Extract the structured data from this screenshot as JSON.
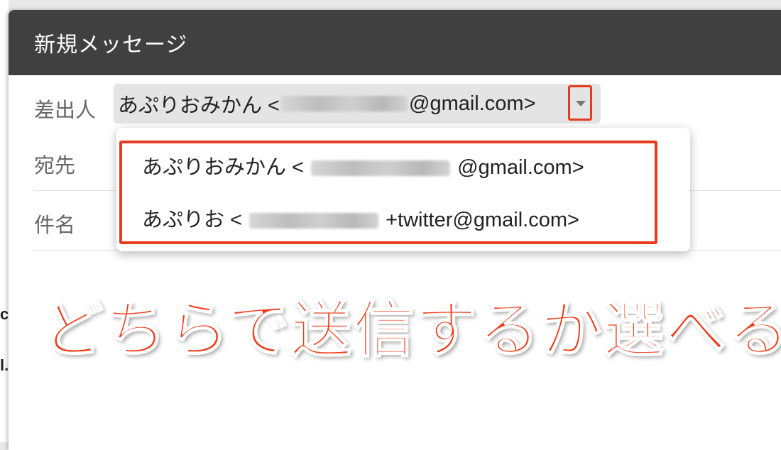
{
  "compose": {
    "title": "新規メッセージ",
    "from_label": "差出人",
    "from_value": {
      "name": "あぷりおみかん <",
      "domain": "@gmail.com>"
    },
    "to_label": "宛先",
    "subject_label": "件名"
  },
  "from_menu": {
    "items": [
      {
        "name": "あぷりおみかん <",
        "domain": "@gmail.com>"
      },
      {
        "name": "あぷりお <",
        "domain": "+twitter@gmail.com>"
      }
    ]
  },
  "annotation": {
    "text": "どちらで送信するか選べる"
  },
  "background": {
    "char_1": "c",
    "char_2": "l."
  },
  "colors": {
    "title_bar": "#404040",
    "highlight_red": "#e63b1f",
    "annotation_red": "#f23a17"
  },
  "icons": {
    "dropdown": "caret-down-icon"
  }
}
